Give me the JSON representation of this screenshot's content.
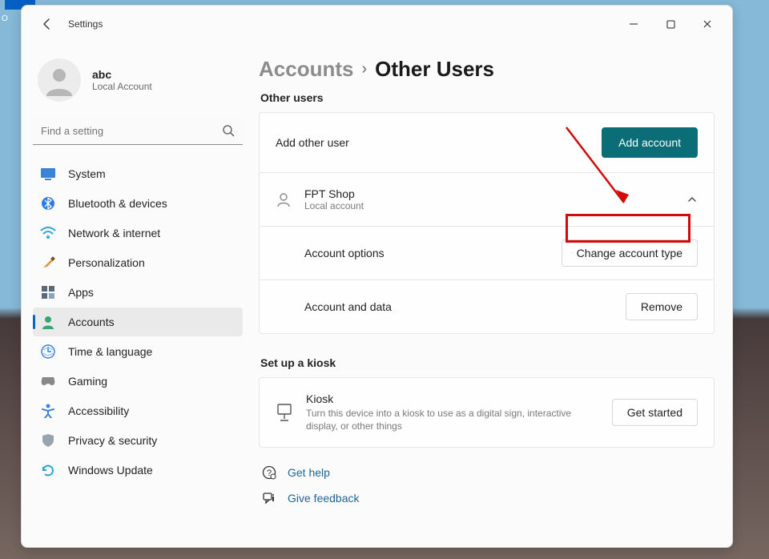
{
  "titlebar": {
    "label": "Settings"
  },
  "profile": {
    "name": "abc",
    "subtitle": "Local Account"
  },
  "search": {
    "placeholder": "Find a setting"
  },
  "nav": {
    "system": "System",
    "bluetooth": "Bluetooth & devices",
    "network": "Network & internet",
    "personal": "Personalization",
    "apps": "Apps",
    "accounts": "Accounts",
    "time": "Time & language",
    "gaming": "Gaming",
    "access": "Accessibility",
    "privacy": "Privacy & security",
    "update": "Windows Update"
  },
  "breadcrumb": {
    "parent": "Accounts",
    "current": "Other Users"
  },
  "other_users": {
    "section_label": "Other users",
    "add_label": "Add other user",
    "add_button": "Add account",
    "user_name": "FPT Shop",
    "user_type": "Local account",
    "account_options_label": "Account options",
    "change_type_button": "Change account type",
    "account_data_label": "Account and data",
    "remove_button": "Remove"
  },
  "kiosk": {
    "section_label": "Set up a kiosk",
    "title": "Kiosk",
    "description": "Turn this device into a kiosk to use as a digital sign, interactive display, or other things",
    "button": "Get started"
  },
  "links": {
    "help": "Get help",
    "feedback": "Give feedback"
  }
}
